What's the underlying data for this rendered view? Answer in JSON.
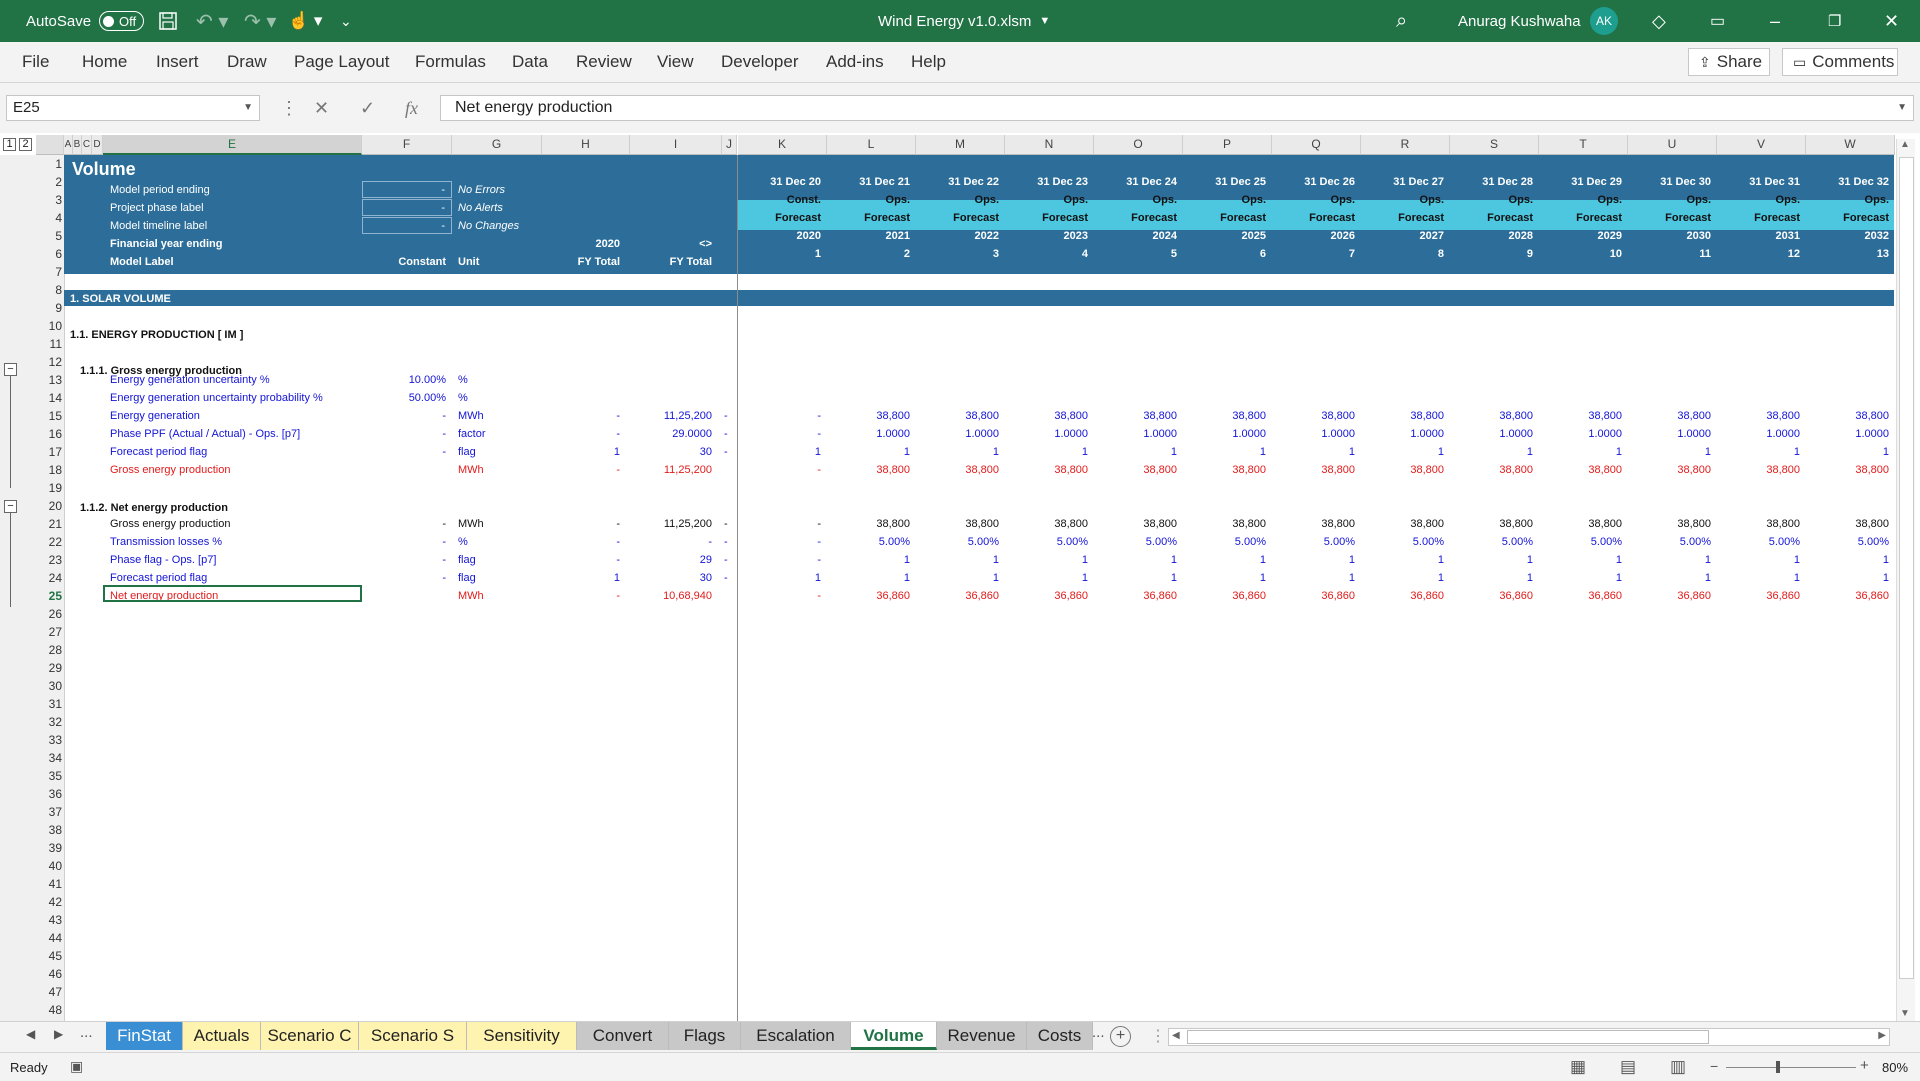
{
  "titlebar": {
    "autosave": "AutoSave",
    "autosave_state": "Off",
    "filename": "Wind Energy v1.0.xlsm",
    "user": "Anurag Kushwaha",
    "initials": "AK"
  },
  "ribbon": {
    "tabs": [
      "File",
      "Home",
      "Insert",
      "Draw",
      "Page Layout",
      "Formulas",
      "Data",
      "Review",
      "View",
      "Developer",
      "Add-ins",
      "Help"
    ],
    "share": "Share",
    "comments": "Comments"
  },
  "formula_bar": {
    "cell_ref": "E25",
    "content": "Net energy production",
    "fx": "fx"
  },
  "columns": {
    "left": [
      "A",
      "B",
      "C",
      "D",
      "E",
      "F",
      "G",
      "H",
      "I",
      "J"
    ],
    "right": [
      "K",
      "L",
      "M",
      "N",
      "O",
      "P",
      "Q",
      "R",
      "S",
      "T",
      "U",
      "V",
      "W"
    ]
  },
  "header": {
    "title": "Volume",
    "labels": [
      "Model period ending",
      "Project phase label",
      "Model timeline label",
      "Financial year ending",
      "Model Label"
    ],
    "inputs": [
      "-",
      "-",
      "-"
    ],
    "checks": [
      "No Errors",
      "No Alerts",
      "No Changes"
    ],
    "h5": "2020",
    "i5": "<>",
    "f6": "Constant",
    "g6": "Unit",
    "h6": "FY Total",
    "i6": "FY Total",
    "dates": [
      "31 Dec 20",
      "31 Dec 21",
      "31 Dec 22",
      "31 Dec 23",
      "31 Dec 24",
      "31 Dec 25",
      "31 Dec 26",
      "31 Dec 27",
      "31 Dec 28",
      "31 Dec 29",
      "31 Dec 30",
      "31 Dec 31",
      "31 Dec 32"
    ],
    "phases": [
      "Const.",
      "Ops.",
      "Ops.",
      "Ops.",
      "Ops.",
      "Ops.",
      "Ops.",
      "Ops.",
      "Ops.",
      "Ops.",
      "Ops.",
      "Ops.",
      "Ops."
    ],
    "timeline": [
      "Forecast",
      "Forecast",
      "Forecast",
      "Forecast",
      "Forecast",
      "Forecast",
      "Forecast",
      "Forecast",
      "Forecast",
      "Forecast",
      "Forecast",
      "Forecast",
      "Forecast"
    ],
    "years": [
      "2020",
      "2021",
      "2022",
      "2023",
      "2024",
      "2025",
      "2026",
      "2027",
      "2028",
      "2029",
      "2030",
      "2031",
      "2032"
    ],
    "periods": [
      "1",
      "2",
      "3",
      "4",
      "5",
      "6",
      "7",
      "8",
      "9",
      "10",
      "11",
      "12",
      "13"
    ]
  },
  "sections": {
    "s8": "1. SOLAR VOLUME",
    "s10": "1.1. ENERGY PRODUCTION [ IM ]",
    "s12": "1.1.1. Gross energy production",
    "s20": "1.1.2. Net energy production"
  },
  "rows": [
    {
      "row": 13,
      "label": "Energy generation uncertainty %",
      "f": "10.00%",
      "g": "%",
      "h": "",
      "i": "",
      "j": "",
      "k": "",
      "vals": [],
      "color": "bl"
    },
    {
      "row": 14,
      "label": "Energy generation uncertainty probability %",
      "f": "50.00%",
      "g": "%",
      "h": "",
      "i": "",
      "j": "",
      "k": "",
      "vals": [],
      "color": "bl"
    },
    {
      "row": 15,
      "label": "Energy generation",
      "f": "-",
      "g": "MWh",
      "h": "-",
      "i": "11,25,200",
      "j": "-",
      "k": "-",
      "vals": [
        "38,800",
        "38,800",
        "38,800",
        "38,800",
        "38,800",
        "38,800",
        "38,800",
        "38,800",
        "38,800",
        "38,800",
        "38,800",
        "38,800"
      ],
      "color": "bl"
    },
    {
      "row": 16,
      "label": "Phase PPF (Actual / Actual) - Ops. [p7]",
      "f": "-",
      "g": "factor",
      "h": "-",
      "i": "29.0000",
      "j": "-",
      "k": "-",
      "vals": [
        "1.0000",
        "1.0000",
        "1.0000",
        "1.0000",
        "1.0000",
        "1.0000",
        "1.0000",
        "1.0000",
        "1.0000",
        "1.0000",
        "1.0000",
        "1.0000"
      ],
      "color": "bl"
    },
    {
      "row": 17,
      "label": "Forecast period flag",
      "f": "-",
      "g": "flag",
      "h": "1",
      "i": "30",
      "j": "-",
      "k": "1",
      "vals": [
        "1",
        "1",
        "1",
        "1",
        "1",
        "1",
        "1",
        "1",
        "1",
        "1",
        "1",
        "1"
      ],
      "color": "bl"
    },
    {
      "row": 18,
      "label": "Gross energy production",
      "f": "",
      "g": "MWh",
      "h": "-",
      "i": "11,25,200",
      "j": "",
      "k": "-",
      "vals": [
        "38,800",
        "38,800",
        "38,800",
        "38,800",
        "38,800",
        "38,800",
        "38,800",
        "38,800",
        "38,800",
        "38,800",
        "38,800",
        "38,800"
      ],
      "color": "rd"
    },
    {
      "row": 21,
      "label": "Gross energy production",
      "f": "-",
      "g": "MWh",
      "h": "-",
      "i": "11,25,200",
      "j": "-",
      "k": "-",
      "vals": [
        "38,800",
        "38,800",
        "38,800",
        "38,800",
        "38,800",
        "38,800",
        "38,800",
        "38,800",
        "38,800",
        "38,800",
        "38,800",
        "38,800"
      ],
      "color": "bk"
    },
    {
      "row": 22,
      "label": "Transmission losses %",
      "f": "-",
      "g": "%",
      "h": "-",
      "i": "-",
      "j": "-",
      "k": "-",
      "vals": [
        "5.00%",
        "5.00%",
        "5.00%",
        "5.00%",
        "5.00%",
        "5.00%",
        "5.00%",
        "5.00%",
        "5.00%",
        "5.00%",
        "5.00%",
        "5.00%"
      ],
      "color": "bl"
    },
    {
      "row": 23,
      "label": "Phase flag - Ops. [p7]",
      "f": "-",
      "g": "flag",
      "h": "-",
      "i": "29",
      "j": "-",
      "k": "-",
      "vals": [
        "1",
        "1",
        "1",
        "1",
        "1",
        "1",
        "1",
        "1",
        "1",
        "1",
        "1",
        "1"
      ],
      "color": "bl"
    },
    {
      "row": 24,
      "label": "Forecast period flag",
      "f": "-",
      "g": "flag",
      "h": "1",
      "i": "30",
      "j": "-",
      "k": "1",
      "vals": [
        "1",
        "1",
        "1",
        "1",
        "1",
        "1",
        "1",
        "1",
        "1",
        "1",
        "1",
        "1"
      ],
      "color": "bl"
    },
    {
      "row": 25,
      "label": "Net energy production",
      "f": "",
      "g": "MWh",
      "h": "-",
      "i": "10,68,940",
      "j": "",
      "k": "-",
      "vals": [
        "36,860",
        "36,860",
        "36,860",
        "36,860",
        "36,860",
        "36,860",
        "36,860",
        "36,860",
        "36,860",
        "36,860",
        "36,860",
        "36,860"
      ],
      "color": "rd"
    }
  ],
  "sheet_tabs": [
    {
      "name": "FinStat",
      "style": "blue"
    },
    {
      "name": "Actuals",
      "style": "yellow"
    },
    {
      "name": "Scenario C",
      "style": "yellow"
    },
    {
      "name": "Scenario S",
      "style": "yellow"
    },
    {
      "name": "Sensitivity",
      "style": "yellow"
    },
    {
      "name": "Convert",
      "style": "gray"
    },
    {
      "name": "Flags",
      "style": "gray"
    },
    {
      "name": "Escalation",
      "style": "gray"
    },
    {
      "name": "Volume",
      "style": "active"
    },
    {
      "name": "Revenue",
      "style": "gray"
    },
    {
      "name": "Costs",
      "style": "gray"
    }
  ],
  "tabs_more": "...",
  "status": {
    "ready": "Ready",
    "zoom": "80%"
  },
  "colors": {
    "excel_green": "#217346",
    "header_blue": "#2c6e99",
    "cyan": "#4dc6df",
    "input_blue": "#1414d7",
    "calc_red": "#e21b1b"
  },
  "outline_levels": [
    "1",
    "2"
  ]
}
